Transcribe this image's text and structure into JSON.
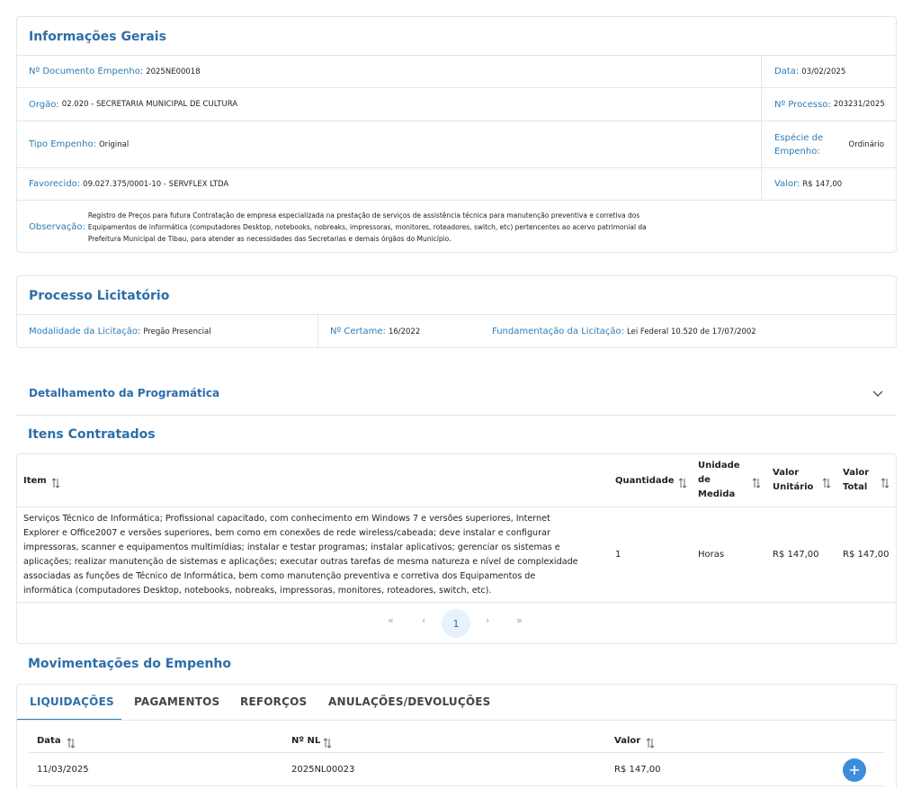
{
  "geral": {
    "title": "Informações Gerais",
    "documento": {
      "label": "Nº Documento Empenho:",
      "value": "2025NE00018"
    },
    "data": {
      "label": "Data:",
      "value": "03/02/2025"
    },
    "orgao": {
      "label": "Orgão:",
      "value": "02.020 - SECRETARIA MUNICIPAL DE CULTURA"
    },
    "processo": {
      "label": "Nº Processo:",
      "value": "203231/2025"
    },
    "tipo": {
      "label": "Tipo Empenho:",
      "value": "Original"
    },
    "especie": {
      "label_line1": "Espécie de",
      "label_line2": "Empenho:",
      "value": "Ordinário"
    },
    "favorecido": {
      "label": "Favorecido:",
      "value": "09.027.375/0001-10 - SERVFLEX LTDA"
    },
    "valor": {
      "label": "Valor:",
      "value": "R$ 147,00"
    },
    "observacao": {
      "label": "Observação:",
      "line1": "Registro de Preços para futura Contratação de empresa especializada na prestação de serviços de assistência técnica para manutenção preventiva e corretiva dos",
      "line2": "Equipamentos de informática (computadores Desktop, notebooks, nobreaks, impressoras, monitores, roteadores, switch, etc) pertencentes ao acervo patrimonial da",
      "line3": "Prefeitura Municipal de Tibau, para atender as necessidades das Secretarias e demais órgãos do Município."
    }
  },
  "licitacao": {
    "title": "Processo Licitatório",
    "modalidade": {
      "label": "Modalidade da Licitação:",
      "value": "Pregão Presencial"
    },
    "certame": {
      "label": "Nº Certame:",
      "value": "16/2022"
    },
    "fundamentacao": {
      "label": "Fundamentação da Licitação:",
      "value": "Lei Federal 10.520 de 17/07/2002"
    }
  },
  "programatica": {
    "title": "Detalhamento da Programática"
  },
  "itens": {
    "title": "Itens Contratados",
    "headers": {
      "item": "Item",
      "quantidade": "Quantidade",
      "unidade_l1": "Unidade",
      "unidade_l2": "de",
      "unidade_l3": "Medida",
      "unitario_l1": "Valor",
      "unitario_l2": "Unitário",
      "total_l1": "Valor",
      "total_l2": "Total"
    },
    "rows": [
      {
        "desc_lines": [
          "Serviços Técnico de Informática; Profissional capacitado, com conhecimento em Windows 7 e versões superiores, Internet",
          "Explorer e Office2007 e versões superiores, bem como em conexões de rede wireless/cabeada; deve instalar e configurar",
          "impressoras, scanner e equipamentos multimídias; instalar e testar programas; instalar aplicativos; gerenciar os sistemas e",
          "aplicações; realizar manutenção de sistemas e aplicações; executar outras tarefas de mesma natureza e nível de complexidade",
          "associadas as funções de Técnico de Informática, bem como manutenção preventiva e corretiva dos Equipamentos de",
          "informática (computadores Desktop, notebooks, nobreaks, impressoras, monitores, roteadores, switch, etc)."
        ],
        "quantidade": "1",
        "unidade": "Horas",
        "valor_unitario": "R$ 147,00",
        "valor_total": "R$ 147,00"
      }
    ],
    "pager": {
      "first": "«",
      "prev": "‹",
      "current": "1",
      "next": "›",
      "last": "»"
    }
  },
  "movimentacoes": {
    "title": "Movimentações do Empenho",
    "tabs": [
      "LIQUIDAÇÕES",
      "PAGAMENTOS",
      "REFORÇOS",
      "ANULAÇÕES/DEVOLUÇÕES"
    ],
    "headers": {
      "data": "Data",
      "nl": "Nº NL",
      "valor": "Valor"
    },
    "rows": [
      {
        "data": "11/03/2025",
        "nl": "2025NL00023",
        "valor": "R$ 147,00"
      }
    ]
  }
}
